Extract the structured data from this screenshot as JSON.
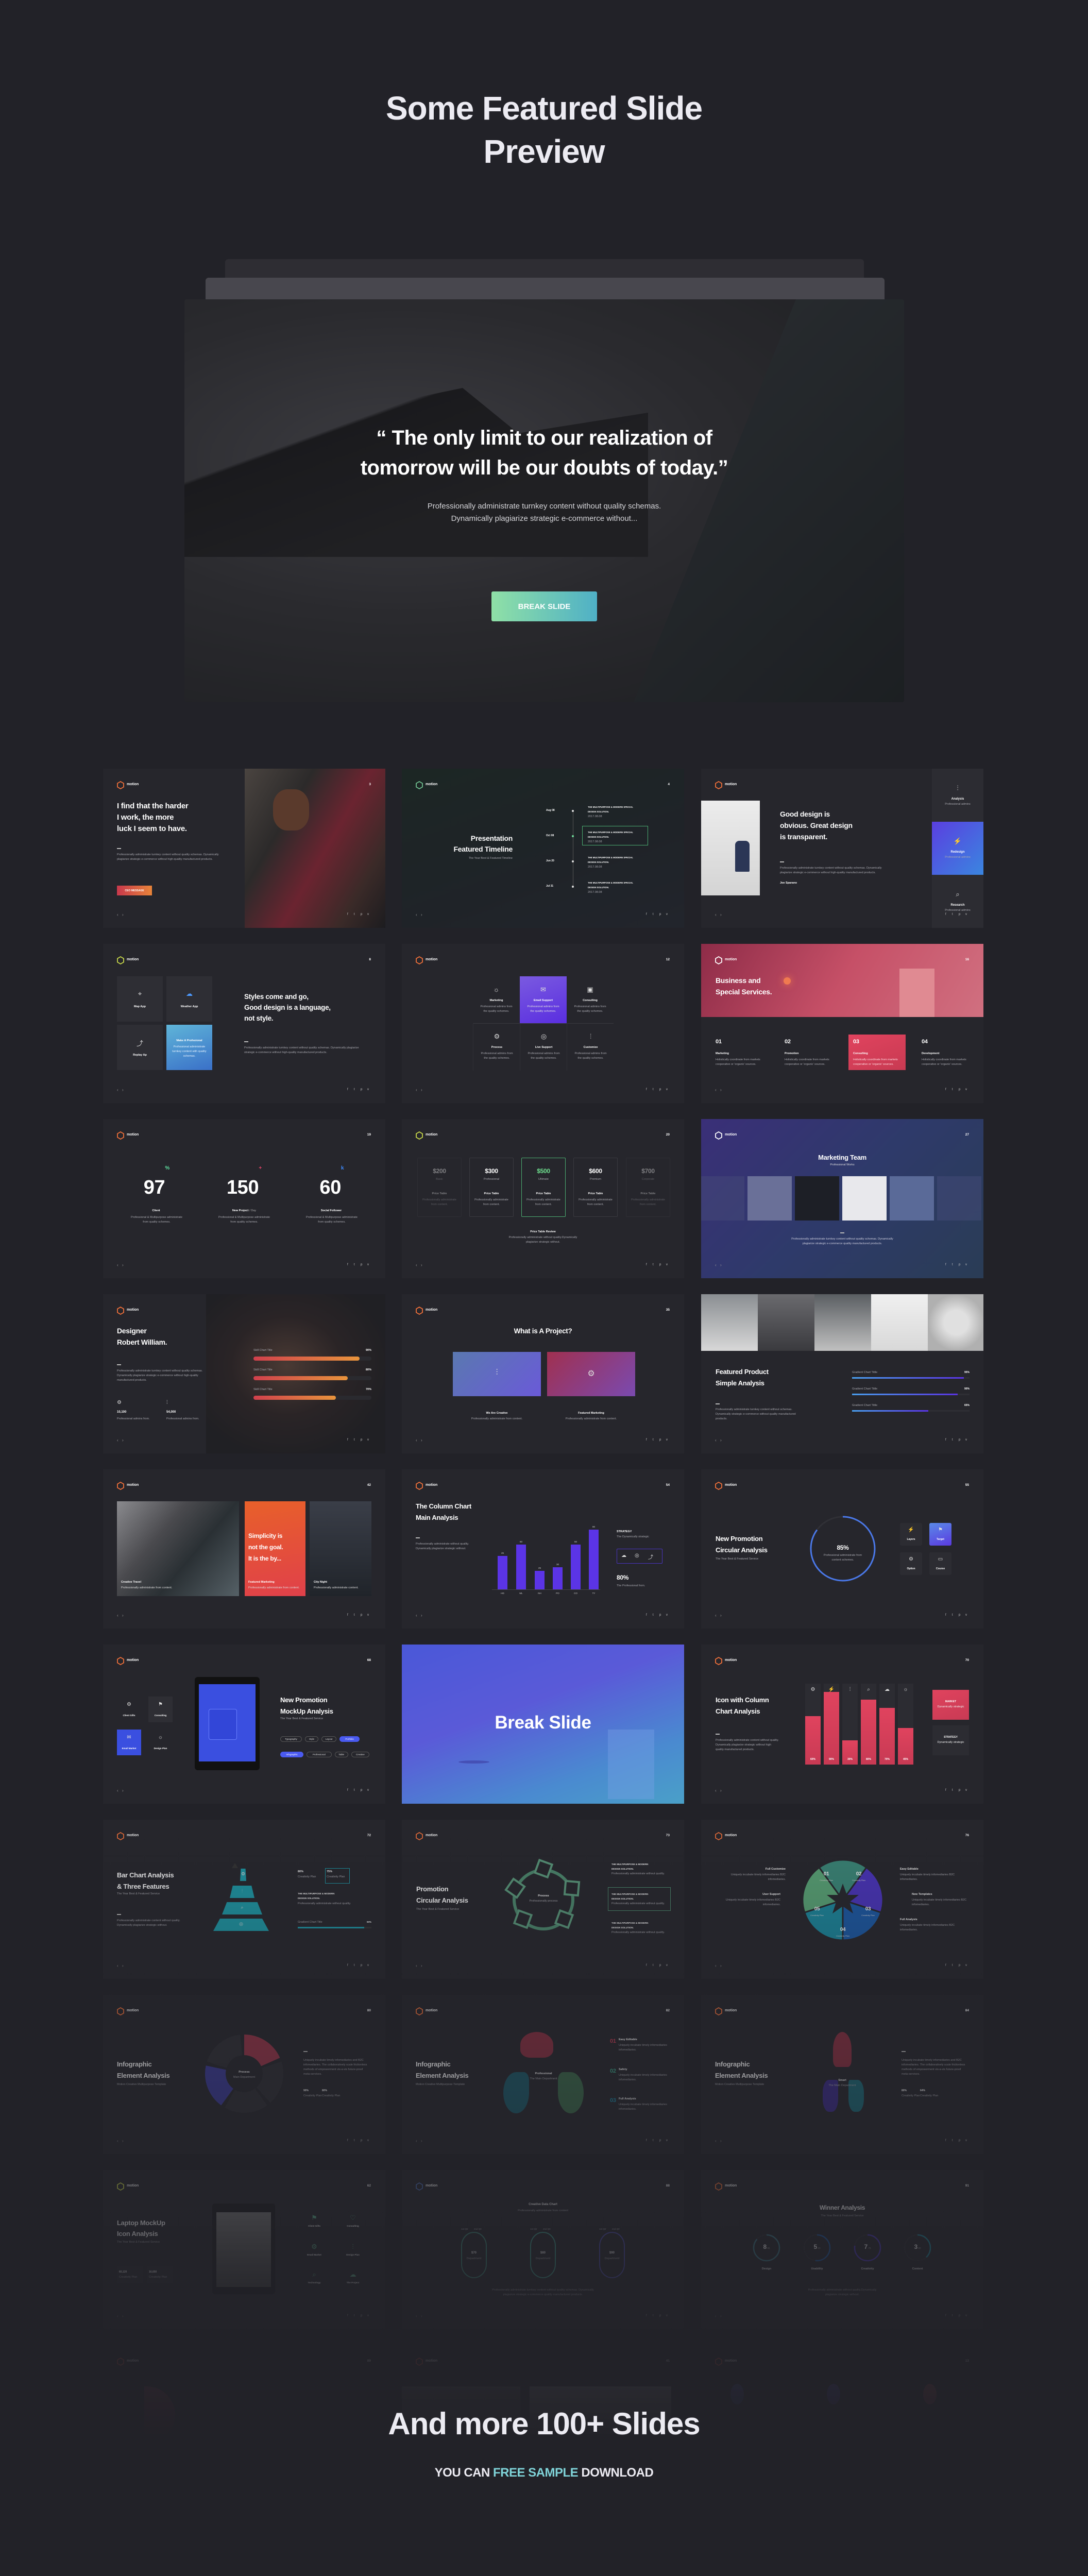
{
  "header": {
    "title_line1": "Some Featured Slide",
    "title_line2": "Preview"
  },
  "hero": {
    "quote_line1": "“ The only limit to our realization of",
    "quote_line2": "tomorrow will be our doubts of today.”",
    "body_line1": "Professionally administrate turnkey content without quality schemas.",
    "body_line2": "Dynamically plagiarize strategic e-commerce without...",
    "button": "BREAK SLIDE"
  },
  "brand": "motion",
  "colors": {
    "background": "#222228",
    "slide": "#26262c",
    "accent_purple": "#5b34e6",
    "accent_red": "#e0435e",
    "accent_teal": "#7fd3d8",
    "logo_orange": "#f0703a"
  },
  "slides": [
    {
      "type": "quote",
      "page": "3",
      "title": [
        "I find that the harder",
        "I work, the more",
        "luck I seem to have."
      ],
      "body": [
        "Professionally administrate turnkey content without quality schemas. Dynamically",
        "plagiarize strategic e-commerce without high-quality manufactured products."
      ],
      "button": "CEO MESSAGE"
    },
    {
      "type": "timeline",
      "page": "4",
      "title": [
        "Presentation",
        "Featured Timeline"
      ],
      "subtitle": "The Year Best & Featured Timeline",
      "events": [
        {
          "date": "Aug 08",
          "line1": "THE MULTIPURPOSE & MODERN SPECIAL",
          "line2": "DESIGN SOLUTION.",
          "stamp": "2017.08.08"
        },
        {
          "date": "Oct 08",
          "line1": "THE MULTIPURPOSE & MODERN SPECIAL",
          "line2": "DESIGN SOLUTION.",
          "stamp": "2017.08.08"
        },
        {
          "date": "Jun 20",
          "line1": "THE MULTIPURPOSE & MODERN SPECIAL",
          "line2": "DESIGN SOLUTION.",
          "stamp": "2017.08.08"
        },
        {
          "date": "Jul 31",
          "line1": "THE MULTIPURPOSE & MODERN SPECIAL",
          "line2": "DESIGN SOLUTION.",
          "stamp": "2017.08.08"
        }
      ]
    },
    {
      "type": "design",
      "title": [
        "Good design is",
        "obvious. Great design",
        "is transparent."
      ],
      "body": [
        "Professionally administrate turnkey content without quality schemas. Dynamically",
        "plagiarize strategic e-commerce without high-quality manufactured products."
      ],
      "author": "Joe Sparano",
      "features": [
        {
          "label": "Analysis",
          "sub": "Professional admins",
          "icon": "sliders-icon"
        },
        {
          "label": "Redesign",
          "sub": "Professional admins",
          "icon": "bolt-icon"
        },
        {
          "label": "Research",
          "sub": "Professional admins",
          "icon": "search-icon"
        }
      ]
    },
    {
      "type": "styles",
      "page": "8",
      "tiles": [
        {
          "label": "Map App",
          "icon": "map-pin-icon"
        },
        {
          "label": "Weather App",
          "icon": "cloud-icon"
        },
        {
          "label": "Replay Ap",
          "icon": "arrow-icon"
        },
        {
          "label": "Make A Profesional",
          "sub": [
            "Professional administrate",
            "turnkey content with quality",
            "schemas."
          ]
        }
      ],
      "title": [
        "Styles come and go,",
        "Good design is a language,",
        "not style."
      ],
      "body": [
        "Professionally administrate turnkey content without quality schemas. Dynamically plagiarize",
        "strategic e-commerce without high-quality manufactured products."
      ]
    },
    {
      "type": "services",
      "page": "12",
      "items": [
        {
          "label": "Marketing",
          "icon": "lightbulb-icon"
        },
        {
          "label": "Email Support",
          "icon": "mail-icon"
        },
        {
          "label": "Consulting",
          "icon": "briefcase-icon"
        },
        {
          "label": "Process",
          "icon": "gear-icon"
        },
        {
          "label": "Live Support",
          "icon": "support-icon"
        },
        {
          "label": "Customize",
          "icon": "sliders-icon"
        }
      ],
      "sub": [
        "Professional admins from",
        "the quality schemes."
      ]
    },
    {
      "type": "business",
      "page": "16",
      "title": [
        "Business and",
        "Special Services."
      ],
      "cols": [
        {
          "num": "01",
          "label": "Marketing"
        },
        {
          "num": "02",
          "label": "Promotion"
        },
        {
          "num": "03",
          "label": "Consulting"
        },
        {
          "num": "04",
          "label": "Development"
        }
      ],
      "body": [
        "Holistically coordinate from markets",
        "cooperative or 'organic' sources."
      ]
    },
    {
      "type": "stats",
      "page": "19",
      "stats": [
        {
          "value": "97",
          "suffix": "%",
          "label": "Client",
          "label_suffix": ""
        },
        {
          "value": "150",
          "suffix": "+",
          "label": "New Project",
          "label_suffix": "/ Day"
        },
        {
          "value": "60",
          "suffix": "k",
          "label": "Social Follower",
          "label_suffix": ""
        }
      ],
      "suffix_colors": [
        "#5ee0a0",
        "#e8456a",
        "#3d8bff"
      ],
      "body": [
        "Professional & Multipurpose administrate",
        "from quality schemes."
      ]
    },
    {
      "type": "price",
      "page": "20",
      "cards": [
        {
          "price": "$200",
          "plan": "Basic"
        },
        {
          "price": "$300",
          "plan": "Professional"
        },
        {
          "price": "$500",
          "plan": "Ultimate"
        },
        {
          "price": "$600",
          "plan": "Premium"
        },
        {
          "price": "$700",
          "plan": "Corporate"
        }
      ],
      "card_title": "Price Table",
      "card_body": [
        "Professionally administrate",
        "from content."
      ],
      "review_title": "Price Table Review",
      "review_body": [
        "Professionally administrate without quality.Dynamically",
        "plagiarize strategic without."
      ]
    },
    {
      "type": "team",
      "page": "27",
      "title": "Marketing Team",
      "subtitle": "Professional Works",
      "body": [
        "Professionally administrate turnkey content without quality schemas. Dynamically",
        "plagiarize strategic e-commerce quality manufactured products."
      ]
    },
    {
      "type": "designer",
      "title": [
        "Designer",
        "Robert William."
      ],
      "skills": [
        {
          "label": "Skill Chart Title",
          "value": "90%",
          "percent": 90
        },
        {
          "label": "Skill Chart Title",
          "value": "80%",
          "percent": 80
        },
        {
          "label": "Skill Chart Title",
          "value": "70%",
          "percent": 70
        }
      ],
      "body": [
        "Professionally administrate turnkey content without quality schemas.",
        "Dynamically plagiarize strategic e-commerce without high-quality",
        "manufactured products."
      ],
      "stats": [
        {
          "value": "10,100",
          "label": "Professional admins from."
        },
        {
          "value": "54,000",
          "label": "Professional admins from."
        }
      ]
    },
    {
      "type": "project",
      "page": "35",
      "title": "What is A Project?",
      "items": [
        {
          "label": "We Are Creative",
          "sub": "Professionally administrate from content."
        },
        {
          "label": "Featured Marketing",
          "sub": "Professionally administrate from content."
        }
      ]
    },
    {
      "type": "product",
      "title": [
        "Featured Product",
        "Simple Analysis"
      ],
      "body": [
        "Professionally administrate turnkey content without schemas.",
        "Dynamically strategic e-commerce without quality manufactured",
        "products."
      ],
      "bars": [
        {
          "label": "Gradient Chart Tittle",
          "value": "95%",
          "percent": 95
        },
        {
          "label": "Gradient Chart Tittle",
          "value": "90%",
          "percent": 90
        },
        {
          "label": "Gradient Chart Tittle",
          "value": "65%",
          "percent": 65
        }
      ]
    },
    {
      "type": "simplicity",
      "page": "42",
      "cards": [
        {
          "caption": "Creative Travel",
          "sub": "Professionally administrate from content."
        },
        {
          "caption": "Featured Marketing",
          "sub": "Professionally administrate from content."
        },
        {
          "caption": "City Night",
          "sub": "Professionally administrate content."
        }
      ],
      "quote": [
        "Simplicity is",
        "not the goal.",
        "It is the by..."
      ]
    },
    {
      "type": "column",
      "page": "54",
      "title": [
        "The Column Chart",
        "Main Analysis"
      ],
      "body": [
        "Professionally administrate without quality.",
        "Dynamically plagiarize strategic without."
      ],
      "chart": {
        "type": "bar",
        "categories": [
          "HD",
          "ML",
          "NH",
          "PO",
          "CO",
          "TY"
        ],
        "values": [
          45,
          60,
          25,
          30,
          60,
          80
        ],
        "ylim": [
          0,
          90
        ],
        "color": "#5b34e6"
      },
      "strategy": {
        "title": "STRATEGY",
        "sub": "The Dynamically strategic"
      },
      "stat": {
        "value": "80%",
        "label": "The Professional from."
      }
    },
    {
      "type": "circular",
      "page": "55",
      "title": [
        "New Promotion",
        "Circular Analysis"
      ],
      "subtitle": "The Year Best & Featured Service",
      "ring": {
        "percent": 85,
        "label": "85%",
        "text": [
          "Professional administrate from",
          "content schemes."
        ]
      },
      "tiles": [
        {
          "label": "Layers",
          "icon": "bolt-icon"
        },
        {
          "label": "Target",
          "icon": "flag-icon"
        },
        {
          "label": "Option",
          "icon": "gear-icon"
        },
        {
          "label": "Course",
          "icon": "laptop-icon"
        }
      ]
    },
    {
      "type": "mockup",
      "page": "68",
      "title": [
        "New Promotion",
        "MockUp Analysis"
      ],
      "subtitle": "The Year Best & Featured Service",
      "tags": [
        [
          "Typography",
          "Style",
          "Layout",
          "Portfolio"
        ],
        [
          "Infographic",
          "Professional",
          "Table",
          "Creative"
        ]
      ],
      "icons": [
        {
          "label": "Client Gifts",
          "icon": "gear-icon"
        },
        {
          "label": "Consulting",
          "icon": "flag-icon"
        },
        {
          "label": "Email Market",
          "icon": "mail-icon"
        },
        {
          "label": "Design Plan",
          "icon": "lightbulb-icon"
        }
      ]
    },
    {
      "type": "break",
      "title": "Break Slide"
    },
    {
      "type": "iconcolumn",
      "page": "70",
      "title": [
        "Icon with Column",
        "Chart Analysis"
      ],
      "body": [
        "Professionally administrate content without quality.",
        "Dynamically plagiarize strategic without high",
        "quality manufactured products."
      ],
      "columns": [
        {
          "value": "60%",
          "percent": 60,
          "icon": "gear-icon"
        },
        {
          "value": "90%",
          "percent": 90,
          "icon": "bolt-icon"
        },
        {
          "value": "30%",
          "percent": 30,
          "icon": "sliders-icon"
        },
        {
          "value": "80%",
          "percent": 80,
          "icon": "search-icon"
        },
        {
          "value": "70%",
          "percent": 70,
          "icon": "cloud-icon"
        },
        {
          "value": "45%",
          "percent": 45,
          "icon": "lightbulb-icon"
        }
      ],
      "boxes": [
        {
          "title": "MARKET",
          "sub": "Dynamically strategic"
        },
        {
          "title": "STRATEGY",
          "sub": "Dynamically strategic"
        }
      ]
    },
    {
      "type": "pyramid",
      "page": "72",
      "title": [
        "Bar Chart Analysis",
        "& Three Features"
      ],
      "subtitle": "The Year Best & Featured Service",
      "body": [
        "Professionally administrate content without quality.",
        "Dynamically plagiarize strategic without."
      ],
      "stats": [
        {
          "value": "80%",
          "label": "Creativity Plan"
        },
        {
          "value": "75%",
          "label": "Creativity Plan"
        }
      ],
      "feature": {
        "line1": "THE MULTIPURPOSE & MODERN",
        "line2": "DESIGN SOLUTION.",
        "body": "Professionally administrate without quality."
      },
      "bar": {
        "label": "Gradient Chart Title",
        "value": "90%",
        "percent": 90
      }
    },
    {
      "type": "promo",
      "page": "73",
      "title": [
        "Promotion",
        "Circular Analysis"
      ],
      "subtitle": "The Year Best & Featured Service",
      "center": {
        "title": "Process",
        "sub": "Professionally process"
      },
      "entries": [
        {
          "line1": "THE MULTIPURPOSE & MODERN",
          "line2": "DESIGN SOLUTION.",
          "body": "Professionally administrate without quality."
        },
        {
          "line1": "THE MULTIPURPOSE & MODERN",
          "line2": "DESIGN SOLUTION.",
          "body": "Professionally administrate without quality."
        },
        {
          "line1": "THE MULTIPURPOSE & MODERN",
          "line2": "DESIGN SOLUTION.",
          "body": "Professionally administrate without quality."
        }
      ]
    },
    {
      "type": "star",
      "page": "76",
      "segments": [
        {
          "num": "01",
          "label": "Creativity Plan"
        },
        {
          "num": "02",
          "label": "Creativity Plan"
        },
        {
          "num": "03",
          "label": "Creativity Plan"
        },
        {
          "num": "04",
          "label": "Creativity Plan"
        },
        {
          "num": "05",
          "label": "Creativity Plan"
        }
      ],
      "left": [
        "Full Customize",
        "User Support"
      ],
      "right": [
        "Easy Editable",
        "New Templates",
        "Full Analysis"
      ],
      "body": [
        "Uniquely incubate timely infomediaries B2C",
        "infomediaries."
      ]
    },
    {
      "type": "info1",
      "page": "80",
      "title": [
        "Infographic",
        "Element Analysis"
      ],
      "subtitle": "Motion Creative Multipurpose Template",
      "center": {
        "title": "Process",
        "sub": "Main Department"
      },
      "body": [
        "Uniquely incubate timely infomediaries and B2C",
        "infomediaries. The collaboratively scale frictionless",
        "methods of empowerment vis-a-vis future-proof",
        "meta-services."
      ],
      "stats": [
        {
          "value": "90%",
          "label": "Creativity Plan"
        },
        {
          "value": "80%",
          "label": "Creativity Plan"
        }
      ]
    },
    {
      "type": "info2",
      "page": "82",
      "title": [
        "Infographic",
        "Element Analysis"
      ],
      "subtitle": "Motion Creative Multipurpose Template",
      "center": {
        "title": "Professional",
        "sub": "The Main Department"
      },
      "items": [
        {
          "num": "01",
          "label": "Easy Editable"
        },
        {
          "num": "02",
          "label": "Safety"
        },
        {
          "num": "03",
          "label": "Full Analysis"
        }
      ],
      "item_body": [
        "Uniquely incubate timely infomediaries",
        "infomediaries."
      ]
    },
    {
      "type": "info3",
      "page": "84",
      "title": [
        "Infographic",
        "Element Analysis"
      ],
      "subtitle": "Motion Creative Multipurpose Template",
      "center": {
        "title": "Smart",
        "sub": "The Main Department"
      },
      "body": [
        "Uniquely incubate timely infomediaries and B2C",
        "infomediaries. The collaboratively scale frictionless",
        "methods of empowerment vis-a-vis future-proof",
        "meta-services."
      ],
      "stats": [
        {
          "value": "80%",
          "label": "Creativity Plan"
        },
        {
          "value": "64%",
          "label": "Creativity Plan"
        }
      ]
    },
    {
      "type": "laptop",
      "page": "62",
      "title": [
        "Laptop MockUp",
        "Icon Analysis"
      ],
      "subtitle": "The Year Best & Featured Service",
      "stats": [
        {
          "value": "60,120",
          "label": "Creativity Plan"
        },
        {
          "value": "16,650",
          "label": "Creativity Plan"
        }
      ],
      "icons": [
        {
          "label": "Client Gifts",
          "icon": "flag-icon"
        },
        {
          "label": "Consulting",
          "icon": "heart-icon"
        },
        {
          "label": "Email Market",
          "icon": "gear-icon"
        },
        {
          "label": "Design Plan",
          "icon": "sliders-icon"
        },
        {
          "label": "Technology",
          "icon": "search-icon"
        },
        {
          "label": "The Project",
          "icon": "cloud-icon"
        }
      ]
    },
    {
      "type": "datachart",
      "page": "88",
      "title": "Creative Data Chart",
      "subtitle": "Professionally administrate from content",
      "legend": [
        "1st Qtr",
        "2nd Qtr"
      ],
      "items": [
        {
          "value": "$70",
          "label": "Department"
        },
        {
          "value": "$80",
          "label": "Department"
        },
        {
          "value": "$90",
          "label": "Department"
        }
      ],
      "body": [
        "Professionally administrate turnkey content without quality schemas. Dynamically",
        "plagiarize strategic e-commerce quality manufactured products."
      ]
    },
    {
      "type": "winner",
      "page": "91",
      "title": "Winner Analysis",
      "subtitle": "The Year Best & Featured Service",
      "rings": [
        {
          "int": "8",
          "dec": ".65",
          "label": "Design",
          "value": 8.65
        },
        {
          "int": "5",
          "dec": ".20",
          "label": "Usability",
          "value": 5.2
        },
        {
          "int": "7",
          "dec": ".75",
          "label": "Creativity",
          "value": 7.75
        },
        {
          "int": "3",
          "dec": ".80",
          "label": "Content",
          "value": 3.8
        }
      ],
      "body": [
        "Professionally administrate without quality.Dynamically",
        "plagiarize strategic without."
      ]
    },
    {
      "type": "faded",
      "page": "89"
    },
    {
      "type": "faded",
      "page": "41"
    },
    {
      "type": "faded",
      "page": "13"
    }
  ],
  "footer": {
    "headline": "And more 100+ Slides",
    "cta_prefix": "YOU CAN ",
    "cta_highlight": "FREE SAMPLE",
    "cta_suffix": " DOWNLOAD"
  }
}
